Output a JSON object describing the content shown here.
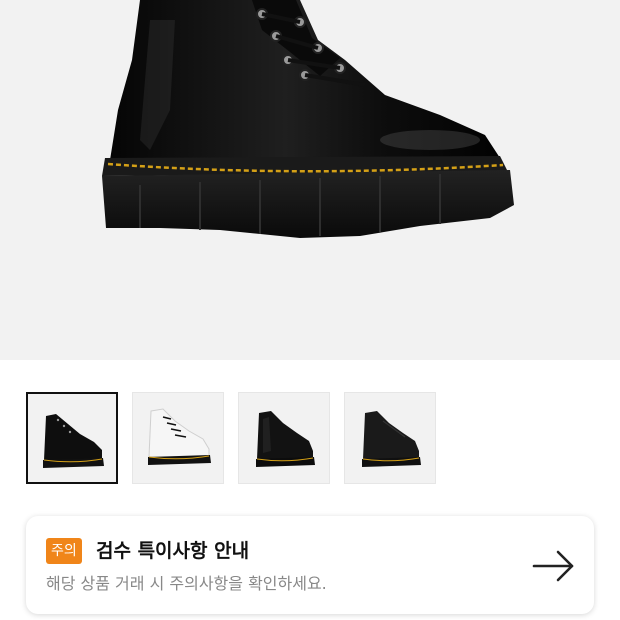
{
  "product_image": {
    "alt_icon": "black-leather-lace-up-platform-boot"
  },
  "thumbnails": [
    {
      "icon": "black-boot-side-view",
      "selected": true
    },
    {
      "icon": "white-boot-side-view",
      "selected": false
    },
    {
      "icon": "black-boot-front-view",
      "selected": false
    },
    {
      "icon": "black-boot-angled-view",
      "selected": false
    }
  ],
  "notice": {
    "badge": "주의",
    "title": "검수 특이사항 안내",
    "description": "해당 상품 거래 시 주의사항을 확인하세요.",
    "arrow_icon": "arrow-right-icon",
    "badge_color": "#f08519"
  },
  "colors": {
    "hero_background": "#f2f2f2",
    "title_text": "#111111",
    "description_text": "#888888"
  }
}
